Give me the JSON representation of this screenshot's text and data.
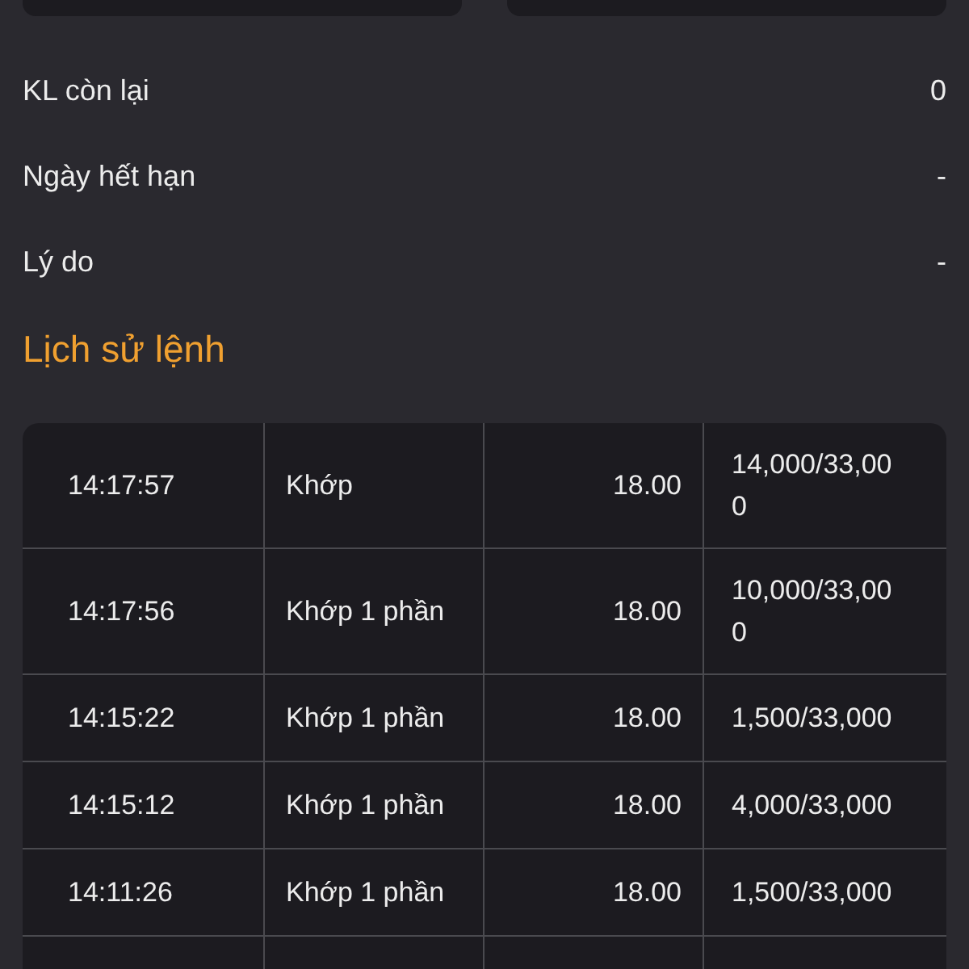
{
  "details": [
    {
      "label": "KL còn lại",
      "value": "0"
    },
    {
      "label": "Ngày hết hạn",
      "value": "-"
    },
    {
      "label": "Lý do",
      "value": "-"
    }
  ],
  "history": {
    "title": "Lịch sử lệnh",
    "rows": [
      {
        "time": "14:17:57",
        "status": "Khớp",
        "price": "18.00",
        "volume": "14,000/33,000"
      },
      {
        "time": "14:17:56",
        "status": "Khớp 1 phần",
        "price": "18.00",
        "volume": "10,000/33,000"
      },
      {
        "time": "14:15:22",
        "status": "Khớp 1 phần",
        "price": "18.00",
        "volume": "1,500/33,000"
      },
      {
        "time": "14:15:12",
        "status": "Khớp 1 phần",
        "price": "18.00",
        "volume": "4,000/33,000"
      },
      {
        "time": "14:11:26",
        "status": "Khớp 1 phần",
        "price": "18.00",
        "volume": "1,500/33,000"
      }
    ]
  }
}
